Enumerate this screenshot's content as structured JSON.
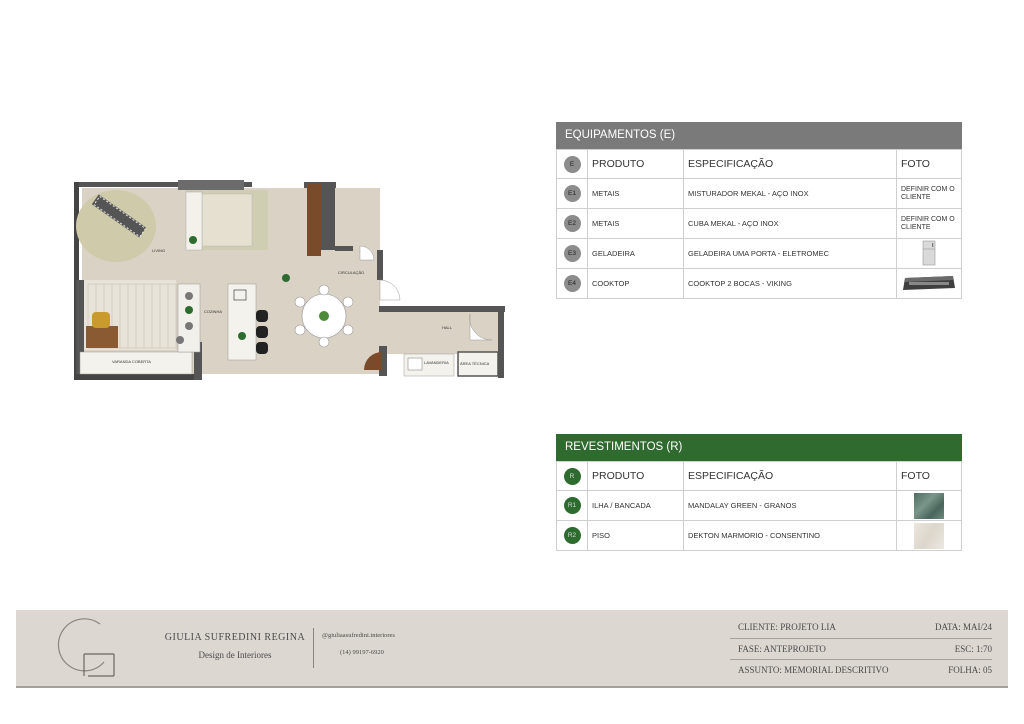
{
  "equipamentos": {
    "title": "EQUIPAMENTOS (E)",
    "header_color": "#7a7a7a",
    "columns": {
      "code": "E",
      "produto": "PRODUTO",
      "especificacao": "ESPECIFICAÇÃO",
      "foto": "FOTO"
    },
    "rows": [
      {
        "code": "E1",
        "produto": "METAIS",
        "especificacao": "MISTURADOR MEKAL - AÇO INOX",
        "foto": "DEFINIR COM O CLIENTE"
      },
      {
        "code": "E2",
        "produto": "METAIS",
        "especificacao": "CUBA MEKAL - AÇO INOX",
        "foto": "DEFINIR COM O CLIENTE"
      },
      {
        "code": "E3",
        "produto": "GELADEIRA",
        "especificacao": "GELADEIRA UMA PORTA - ELETROMEC",
        "foto": ""
      },
      {
        "code": "E4",
        "produto": "COOKTOP",
        "especificacao": "COOKTOP 2 BOCAS -  VIKING",
        "foto": ""
      }
    ]
  },
  "revestimentos": {
    "title": "REVESTIMENTOS (R)",
    "header_color": "#2f6a2f",
    "columns": {
      "code": "R",
      "produto": "PRODUTO",
      "especificacao": "ESPECIFICAÇÃO",
      "foto": "FOTO"
    },
    "rows": [
      {
        "code": "R1",
        "produto": "ILHA / BANCADA",
        "especificacao": "MANDALAY GREEN - GRANOS",
        "swatch": "#5f7f74"
      },
      {
        "code": "R2",
        "produto": "PISO",
        "especificacao": "DEKTON MARMORIO - CONSENTINO",
        "swatch": "#e6e1d8"
      }
    ]
  },
  "plan": {
    "rooms": {
      "living": "LIVING",
      "circulacao": "CIRCULAÇÃO",
      "cozinha": "COZINHA",
      "hall": "HALL",
      "varanda": "VARANDA COBERTA",
      "lavanderia": "LAVANDERIA",
      "area_tecnica": "ÁREA TÉCNICA"
    }
  },
  "footer": {
    "brand_name": "GIULIA SUFREDINI REGINA",
    "brand_sub": "Design de Interiores",
    "instagram": "@giuliaasufredini.interiores",
    "phone": "(14) 99197-6920",
    "cliente": "CLIENTE: PROJETO LIA",
    "fase": "FASE: ANTEPROJETO",
    "assunto": "ASSUNTO: MEMORIAL DESCRITIVO",
    "data": "DATA: MAI/24",
    "esc": "ESC: 1:70",
    "folha": "FOLHA: 05"
  }
}
